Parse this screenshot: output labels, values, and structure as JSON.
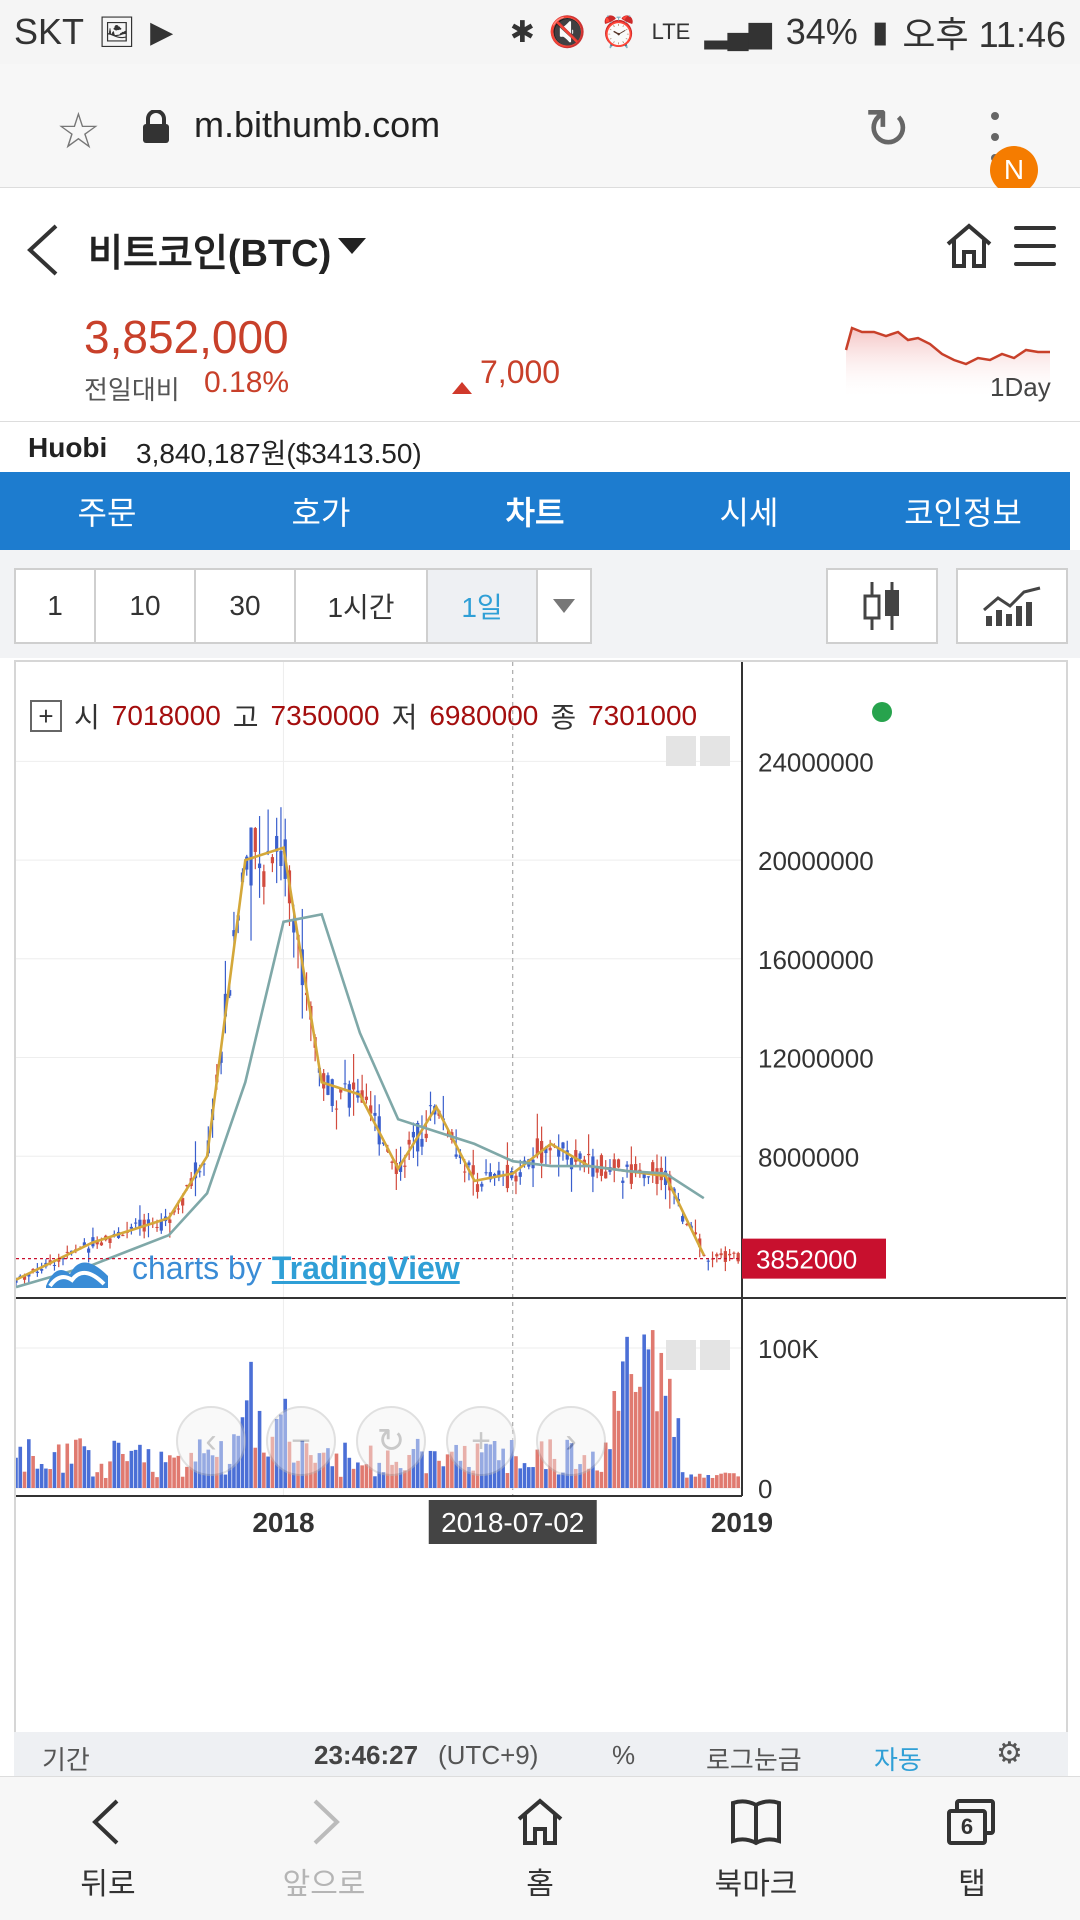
{
  "status_bar": {
    "carrier": "SKT",
    "network": "LTE",
    "battery": "34%",
    "time": "오후 11:46"
  },
  "browser": {
    "url": "m.bithumb.com",
    "profile_badge": "N"
  },
  "header": {
    "coin_title": "비트코인(BTC)"
  },
  "price": {
    "current": "3,852,000",
    "compare_label": "전일대비",
    "change_percent": "0.18%",
    "change_amount": "7,000",
    "spark_label": "1Day"
  },
  "huobi": {
    "name": "Huobi",
    "price": "3,840,187원($3413.50)"
  },
  "tabs": [
    "주문",
    "호가",
    "차트",
    "시세",
    "코인정보"
  ],
  "intervals": [
    "1",
    "10",
    "30",
    "1시간",
    "1일"
  ],
  "ohlc": {
    "open_label": "시",
    "open": "7018000",
    "high_label": "고",
    "high": "7350000",
    "low_label": "저",
    "low": "6980000",
    "close_label": "종",
    "close": "7301000"
  },
  "watermark": {
    "prefix": "charts by",
    "brand": "TradingView"
  },
  "chart_data": {
    "type": "line",
    "price_axis_ticks": [
      "24000000",
      "20000000",
      "16000000",
      "12000000",
      "8000000"
    ],
    "price_ylim": [
      2500000,
      26000000
    ],
    "current_price_label": "3852000",
    "volume_axis_ticks": [
      "100K",
      "0"
    ],
    "x_tick_labels": [
      "2018",
      "2018-07-02",
      "2019"
    ],
    "series": [
      {
        "x": [
          "2017-06",
          "2017-08",
          "2017-10",
          "2017-11",
          "2017-12",
          "2018-01",
          "2018-02",
          "2018-03",
          "2018-04",
          "2018-05",
          "2018-06",
          "2018-07",
          "2018-08",
          "2018-09",
          "2018-10",
          "2018-11",
          "2018-12"
        ],
        "values": [
          3000000,
          4500000,
          5500000,
          8000000,
          20000000,
          20500000,
          11000000,
          10500000,
          7500000,
          10000000,
          7000000,
          7300000,
          8500000,
          7600000,
          7400000,
          7200000,
          4000000
        ],
        "color": "#d4a83a"
      },
      {
        "x": [
          "2017-06",
          "2017-08",
          "2017-10",
          "2017-11",
          "2017-12",
          "2018-01",
          "2018-02",
          "2018-03",
          "2018-04",
          "2018-05",
          "2018-06",
          "2018-07",
          "2018-08",
          "2018-09",
          "2018-10",
          "2018-11",
          "2018-12"
        ],
        "values": [
          2700000,
          3600000,
          4800000,
          6500000,
          11000000,
          17500000,
          17800000,
          13000000,
          9500000,
          9000000,
          8500000,
          7800000,
          7600000,
          7600000,
          7400000,
          7300000,
          6300000
        ],
        "color": "#7fa8a8"
      }
    ],
    "grid": true
  },
  "chart_footer": {
    "period_label": "기간",
    "time": "23:46:27",
    "timezone": "(UTC+9)",
    "percent": "%",
    "log_scale": "로그눈금",
    "auto": "자동"
  },
  "bottom_nav": {
    "back": "뒤로",
    "forward": "앞으로",
    "home": "홈",
    "bookmark": "북마크",
    "tabs": "탭",
    "tab_count": "6"
  },
  "colors": {
    "accent_blue": "#1d7ccf",
    "price_red": "#c8402a",
    "price_tag_bg": "#c8102e",
    "selected_interval": "#2f9fd6"
  }
}
